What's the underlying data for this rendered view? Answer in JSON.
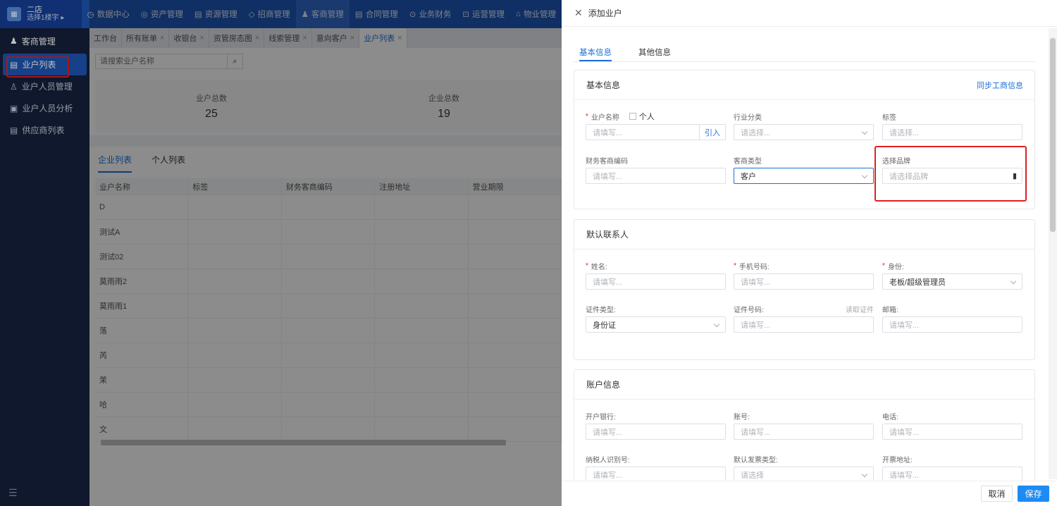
{
  "store": {
    "name": "二店",
    "sub": "选择1楼宇 ▸"
  },
  "nav": [
    "数据中心",
    "资产管理",
    "资源管理",
    "招商管理",
    "客商管理",
    "合同管理",
    "业务财务",
    "运营管理",
    "物业管理"
  ],
  "nav_icons": [
    "◷",
    "◎",
    "▤",
    "◇",
    "♟",
    "▤",
    "⊙",
    "⊡",
    "⌂"
  ],
  "sidebar": {
    "title": "客商管理",
    "items": [
      "业户列表",
      "业户人员管理",
      "业户人员分析",
      "供应商列表"
    ]
  },
  "tabs": [
    "工作台",
    "所有账单",
    "收银台",
    "资管房态图",
    "线索管理",
    "意向客户",
    "业户列表"
  ],
  "search": {
    "placeholder": "请搜索业户名称"
  },
  "stats": [
    {
      "label": "业户总数",
      "value": "25"
    },
    {
      "label": "企业总数",
      "value": "19"
    }
  ],
  "list_tabs": [
    "企业列表",
    "个人列表"
  ],
  "table": {
    "headers": [
      "业户名称",
      "标签",
      "财务客商编码",
      "注册地址",
      "营业期限"
    ],
    "rows": [
      "D",
      "测试A",
      "测试02",
      "莫雨雨2",
      "莫雨雨1",
      "落",
      "芮",
      "茉",
      "哈",
      "文"
    ]
  },
  "drawer": {
    "title": "添加业户",
    "tabs": [
      "基本信息",
      "其他信息"
    ],
    "basic": {
      "title": "基本信息",
      "sync": "同步工商信息",
      "name_label": "业户名称",
      "personal": "个人",
      "name_ph": "请填写...",
      "import": "引入",
      "industry_label": "行业分类",
      "industry_ph": "请选择...",
      "tag_label": "标签",
      "tag_ph": "请选择...",
      "fin_label": "财务客商编码",
      "fin_ph": "请填写...",
      "type_label": "客商类型",
      "type_val": "客户",
      "brand_label": "选择品牌",
      "brand_ph": "请选择品牌"
    },
    "contact": {
      "title": "默认联系人",
      "name_label": "姓名:",
      "name_ph": "请填写...",
      "phone_label": "手机号码:",
      "phone_ph": "请填写...",
      "role_label": "身份:",
      "role_val": "老板/超级管理员",
      "idtype_label": "证件类型:",
      "idtype_val": "身份证",
      "idno_label": "证件号码:",
      "read_id": "读取证件",
      "idno_ph": "请填写...",
      "email_label": "邮箱:",
      "email_ph": "请填写..."
    },
    "account": {
      "title": "账户信息",
      "bank_label": "开户银行:",
      "bank_ph": "请填写...",
      "acct_label": "账号:",
      "acct_ph": "请填写...",
      "tel_label": "电话:",
      "tel_ph": "请填写...",
      "tax_label": "纳税人识别号:",
      "tax_ph": "请填写...",
      "inv_label": "默认发票类型:",
      "inv_ph": "请选择",
      "addr_label": "开票地址:",
      "addr_ph": "请填写..."
    },
    "cancel": "取消",
    "save": "保存"
  }
}
